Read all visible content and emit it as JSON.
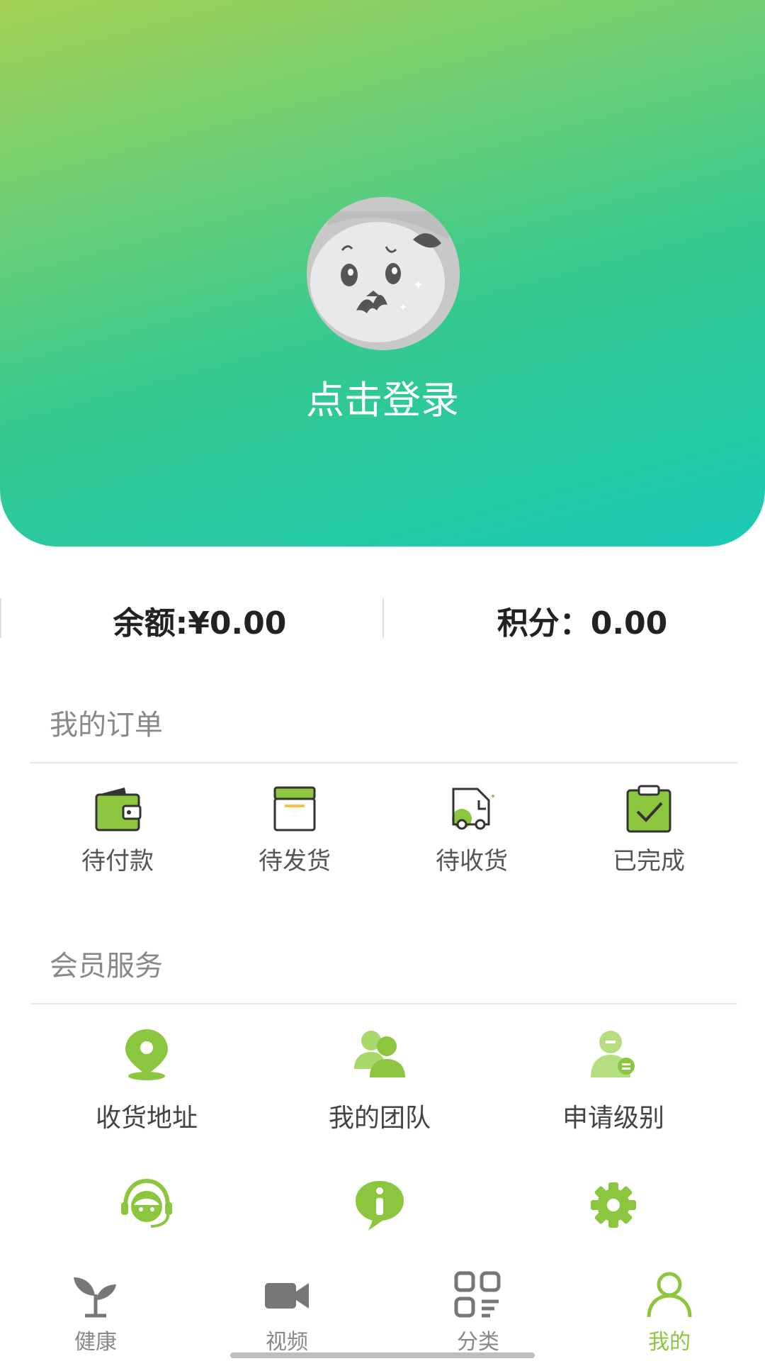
{
  "header": {
    "login_text": "点击登录",
    "gradient_colors": [
      "#a3d152",
      "#34c98e",
      "#1ccab6"
    ]
  },
  "balance": {
    "balance_text": "余额:¥0.00",
    "points_text": "积分：0.00"
  },
  "orders": {
    "title": "我的订单",
    "items": [
      {
        "label": "待付款",
        "icon": "wallet-icon"
      },
      {
        "label": "待发货",
        "icon": "box-icon"
      },
      {
        "label": "待收货",
        "icon": "truck-icon"
      },
      {
        "label": "已完成",
        "icon": "clipboard-check-icon"
      }
    ]
  },
  "services": {
    "title": "会员服务",
    "items": [
      {
        "label": "收货地址",
        "icon": "location-pin-icon"
      },
      {
        "label": "我的团队",
        "icon": "team-icon"
      },
      {
        "label": "申请级别",
        "icon": "user-badge-icon"
      },
      {
        "label": "",
        "icon": "customer-service-icon"
      },
      {
        "label": "",
        "icon": "info-bubble-icon"
      },
      {
        "label": "",
        "icon": "gear-icon"
      }
    ]
  },
  "tabbar": {
    "tabs": [
      {
        "label": "健康",
        "icon": "sprout-icon",
        "active": false
      },
      {
        "label": "视频",
        "icon": "video-camera-icon",
        "active": false
      },
      {
        "label": "分类",
        "icon": "grid-category-icon",
        "active": false
      },
      {
        "label": "我的",
        "icon": "user-icon",
        "active": true
      }
    ]
  },
  "colors": {
    "accent": "#8cc63f",
    "icon_green": "#8cc63f",
    "inactive_tab": "#888888"
  }
}
